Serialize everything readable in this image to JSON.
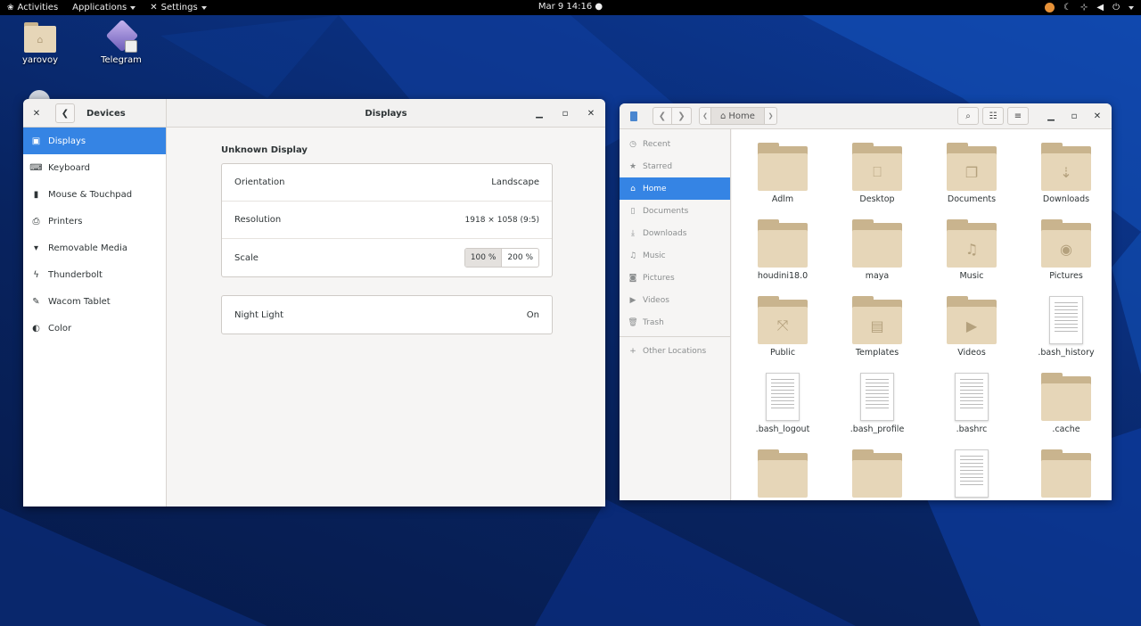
{
  "topbar": {
    "activities": "Activities",
    "applications": "Applications",
    "settings": "Settings",
    "clock": "Mar 9  14:16"
  },
  "desktop": {
    "icons": [
      {
        "label": "yarovoy",
        "icon": "home-folder-icon"
      },
      {
        "label": "Telegram",
        "icon": "telegram-icon"
      }
    ]
  },
  "settings_window": {
    "sidebar_title": "Devices",
    "title": "Displays",
    "sidebar": [
      {
        "label": "Displays",
        "icon": "display-icon",
        "active": true
      },
      {
        "label": "Keyboard",
        "icon": "keyboard-icon"
      },
      {
        "label": "Mouse & Touchpad",
        "icon": "mouse-icon"
      },
      {
        "label": "Printers",
        "icon": "printer-icon"
      },
      {
        "label": "Removable Media",
        "icon": "usb-icon"
      },
      {
        "label": "Thunderbolt",
        "icon": "thunderbolt-icon"
      },
      {
        "label": "Wacom Tablet",
        "icon": "tablet-icon"
      },
      {
        "label": "Color",
        "icon": "color-icon"
      }
    ],
    "section_title": "Unknown Display",
    "orientation_label": "Orientation",
    "orientation_value": "Landscape",
    "resolution_label": "Resolution",
    "resolution_value": "1918 × 1058 (9:5)",
    "scale_label": "Scale",
    "scale_options": [
      "100 %",
      "200 %"
    ],
    "scale_selected": "100 %",
    "night_light_label": "Night Light",
    "night_light_value": "On"
  },
  "files_window": {
    "path": "Home",
    "sidebar": [
      {
        "label": "Recent",
        "icon": "clock-icon"
      },
      {
        "label": "Starred",
        "icon": "star-icon"
      },
      {
        "label": "Home",
        "icon": "home-icon",
        "active": true
      },
      {
        "label": "Documents",
        "icon": "document-icon"
      },
      {
        "label": "Downloads",
        "icon": "download-icon"
      },
      {
        "label": "Music",
        "icon": "music-icon"
      },
      {
        "label": "Pictures",
        "icon": "camera-icon"
      },
      {
        "label": "Videos",
        "icon": "video-icon"
      },
      {
        "label": "Trash",
        "icon": "trash-icon"
      },
      {
        "label": "Other Locations",
        "icon": "plus-icon"
      }
    ],
    "items": [
      {
        "label": "Adlm",
        "type": "folder",
        "emblem": ""
      },
      {
        "label": "Desktop",
        "type": "folder",
        "emblem": "desktop"
      },
      {
        "label": "Documents",
        "type": "folder",
        "emblem": "documents"
      },
      {
        "label": "Downloads",
        "type": "folder",
        "emblem": "downloads"
      },
      {
        "label": "houdini18.0",
        "type": "folder",
        "emblem": ""
      },
      {
        "label": "maya",
        "type": "folder",
        "emblem": ""
      },
      {
        "label": "Music",
        "type": "folder",
        "emblem": "music"
      },
      {
        "label": "Pictures",
        "type": "folder",
        "emblem": "pictures"
      },
      {
        "label": "Public",
        "type": "folder",
        "emblem": "public"
      },
      {
        "label": "Templates",
        "type": "folder",
        "emblem": "templates"
      },
      {
        "label": "Videos",
        "type": "folder",
        "emblem": "videos"
      },
      {
        "label": ".bash_history",
        "type": "file",
        "emblem": ""
      },
      {
        "label": ".bash_logout",
        "type": "file",
        "emblem": ""
      },
      {
        "label": ".bash_profile",
        "type": "file",
        "emblem": ""
      },
      {
        "label": ".bashrc",
        "type": "file",
        "emblem": ""
      },
      {
        "label": ".cache",
        "type": "folder",
        "emblem": ""
      },
      {
        "label": "",
        "type": "folder",
        "emblem": ""
      },
      {
        "label": "",
        "type": "folder",
        "emblem": ""
      },
      {
        "label": "",
        "type": "file",
        "emblem": ""
      },
      {
        "label": "",
        "type": "folder",
        "emblem": ""
      }
    ]
  }
}
